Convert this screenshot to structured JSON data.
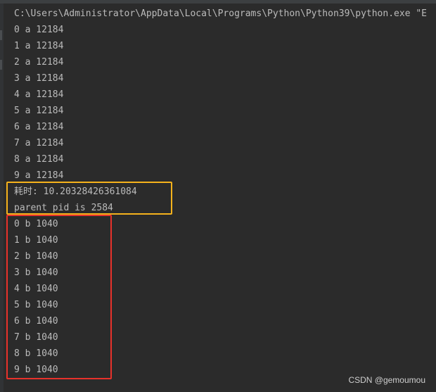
{
  "console": {
    "command_line": "C:\\Users\\Administrator\\AppData\\Local\\Programs\\Python\\Python39\\python.exe \"E",
    "output_lines": [
      "0 a 12184",
      "1 a 12184",
      "2 a 12184",
      "3 a 12184",
      "4 a 12184",
      "5 a 12184",
      "6 a 12184",
      "7 a 12184",
      "8 a 12184",
      "9 a 12184",
      "耗时: 10.20328426361084",
      "parent pid is 2584",
      "0 b 1040",
      "1 b 1040",
      "2 b 1040",
      "3 b 1040",
      "4 b 1040",
      "5 b 1040",
      "6 b 1040",
      "7 b 1040",
      "8 b 1040",
      "9 b 1040"
    ]
  },
  "highlights": [
    {
      "name": "highlight-box-timing",
      "color": "#f5b21c"
    },
    {
      "name": "highlight-box-process-b",
      "color": "#e8322b"
    }
  ],
  "colors": {
    "background": "#2b2b2b",
    "text": "#bbbbbb"
  },
  "watermark": "CSDN @gemoumou"
}
